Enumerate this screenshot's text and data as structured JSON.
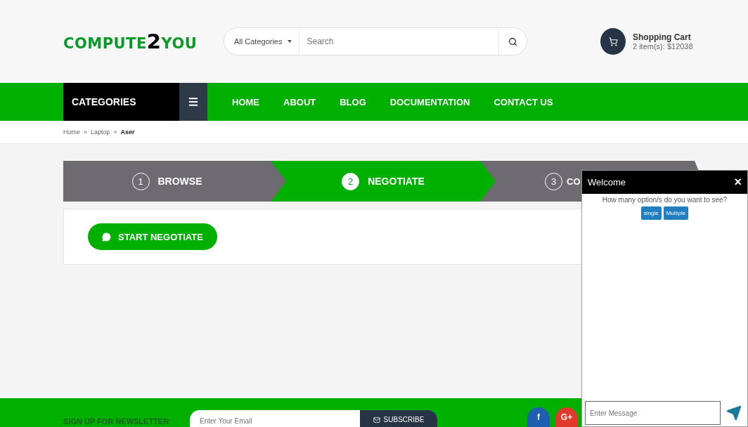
{
  "logo": {
    "text": "COMPUTE",
    "digit": "2",
    "suffix": "YOU"
  },
  "search": {
    "category": "All Categories",
    "placeholder": "Search"
  },
  "cart": {
    "title": "Shopping Cart",
    "summary": "2 item(s): $12038"
  },
  "nav": {
    "categories": "CATEGORIES",
    "items": [
      {
        "label": "HOME"
      },
      {
        "label": "ABOUT"
      },
      {
        "label": "BLOG"
      },
      {
        "label": "DOCUMENTATION"
      },
      {
        "label": "CONTACT US"
      }
    ]
  },
  "breadcrumb": [
    {
      "label": "Home",
      "current": false
    },
    {
      "label": "Laptop",
      "current": false
    },
    {
      "label": "Aser",
      "current": true
    }
  ],
  "breadcrumb_separator": "»",
  "steps": [
    {
      "number": "1",
      "label": "BROWSE",
      "selected": false
    },
    {
      "number": "2",
      "label": "NEGOTIATE",
      "selected": true
    },
    {
      "number": "3",
      "label": "CO",
      "selected": false
    }
  ],
  "start_button": "START NEGOTIATE",
  "chat": {
    "title": "Welcome",
    "close": "×",
    "question": "How many option/s do you want to see?",
    "options": [
      "single",
      "Multiple"
    ],
    "placeholder": "Enter Message"
  },
  "footer": {
    "newsletter": "SIGN UP FOR NEWSLETTER",
    "email_placeholder": "Enter Your Email",
    "subscribe": "SUBSCRIBE",
    "social": [
      {
        "label": "f",
        "color": "#1f5fb0"
      },
      {
        "label": "G+",
        "color": "#e03a2c"
      }
    ]
  }
}
